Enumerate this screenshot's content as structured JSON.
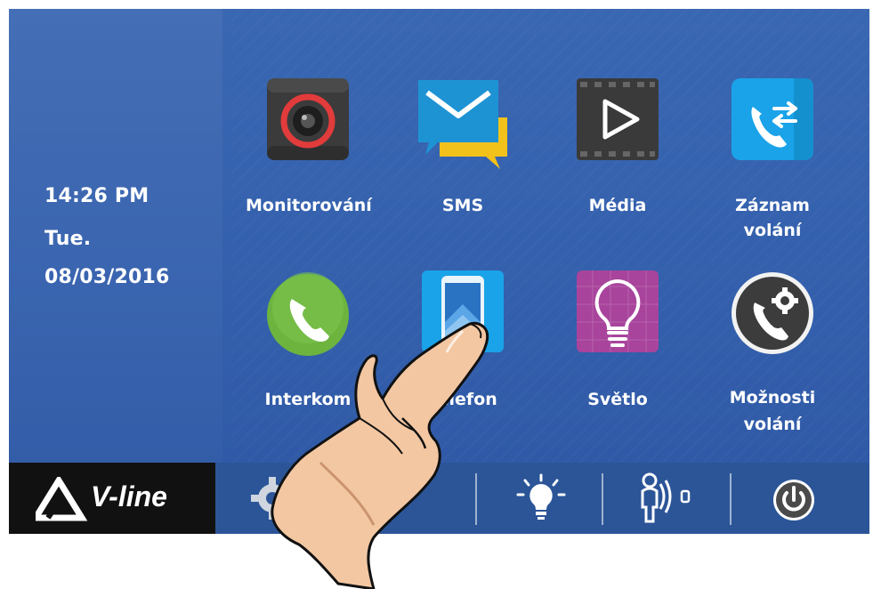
{
  "status": {
    "time": "14:26   PM",
    "day": "Tue.",
    "date": "08/03/2016"
  },
  "apps": [
    {
      "label_line1": "Monitorování",
      "label_line2": "",
      "icon": "camera-icon",
      "color": "#3a3a3a"
    },
    {
      "label_line1": "SMS",
      "label_line2": "",
      "icon": "sms-icon",
      "color": "#1e90d6"
    },
    {
      "label_line1": "Média",
      "label_line2": "",
      "icon": "media-play-icon",
      "color": "#3a3a3a"
    },
    {
      "label_line1": "Záznam",
      "label_line2": "volání",
      "icon": "call-log-icon",
      "color": "#1aa3e8"
    },
    {
      "label_line1": "Interkom",
      "label_line2": "",
      "icon": "intercom-phone-icon",
      "color": "#6fb43f"
    },
    {
      "label_line1": "Telefon",
      "label_line2": "",
      "icon": "mobile-phone-icon",
      "color": "#1aa3e8"
    },
    {
      "label_line1": "Světlo",
      "label_line2": "",
      "icon": "light-bulb-icon",
      "color": "#a9449c"
    },
    {
      "label_line1": "Možnosti",
      "label_line2": "volání",
      "icon": "call-settings-icon",
      "color": "#3a3a3a"
    }
  ],
  "bottom_bar": {
    "brand": "V-line",
    "items": [
      "settings-gear-icon",
      "light-icon",
      "door-unlock-icon",
      "power-icon"
    ]
  }
}
